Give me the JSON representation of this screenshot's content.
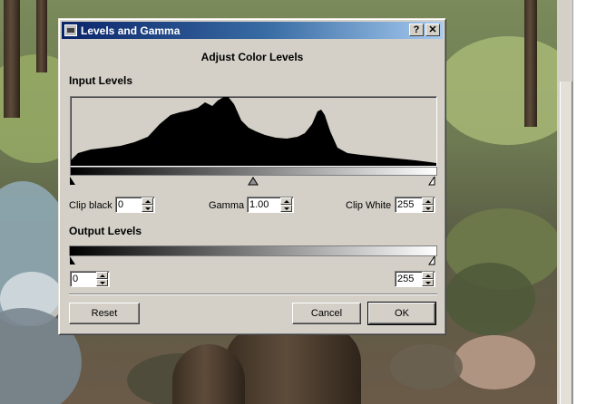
{
  "dialog": {
    "title": "Levels and Gamma",
    "help_label": "?",
    "close_label": "✕",
    "heading": "Adjust Color Levels"
  },
  "input_levels": {
    "label": "Input Levels",
    "clip_black_label": "Clip black",
    "clip_black_value": "0",
    "gamma_label": "Gamma",
    "gamma_value": "1.00",
    "clip_white_label": "Clip White",
    "clip_white_value": "255"
  },
  "output_levels": {
    "label": "Output Levels",
    "low_value": "0",
    "high_value": "255"
  },
  "buttons": {
    "reset": "Reset",
    "cancel": "Cancel",
    "ok": "OK"
  },
  "colors": {
    "titlebar_start": "#0a246a",
    "titlebar_end": "#a6caf0",
    "dialog_face": "#d4d0c8"
  }
}
